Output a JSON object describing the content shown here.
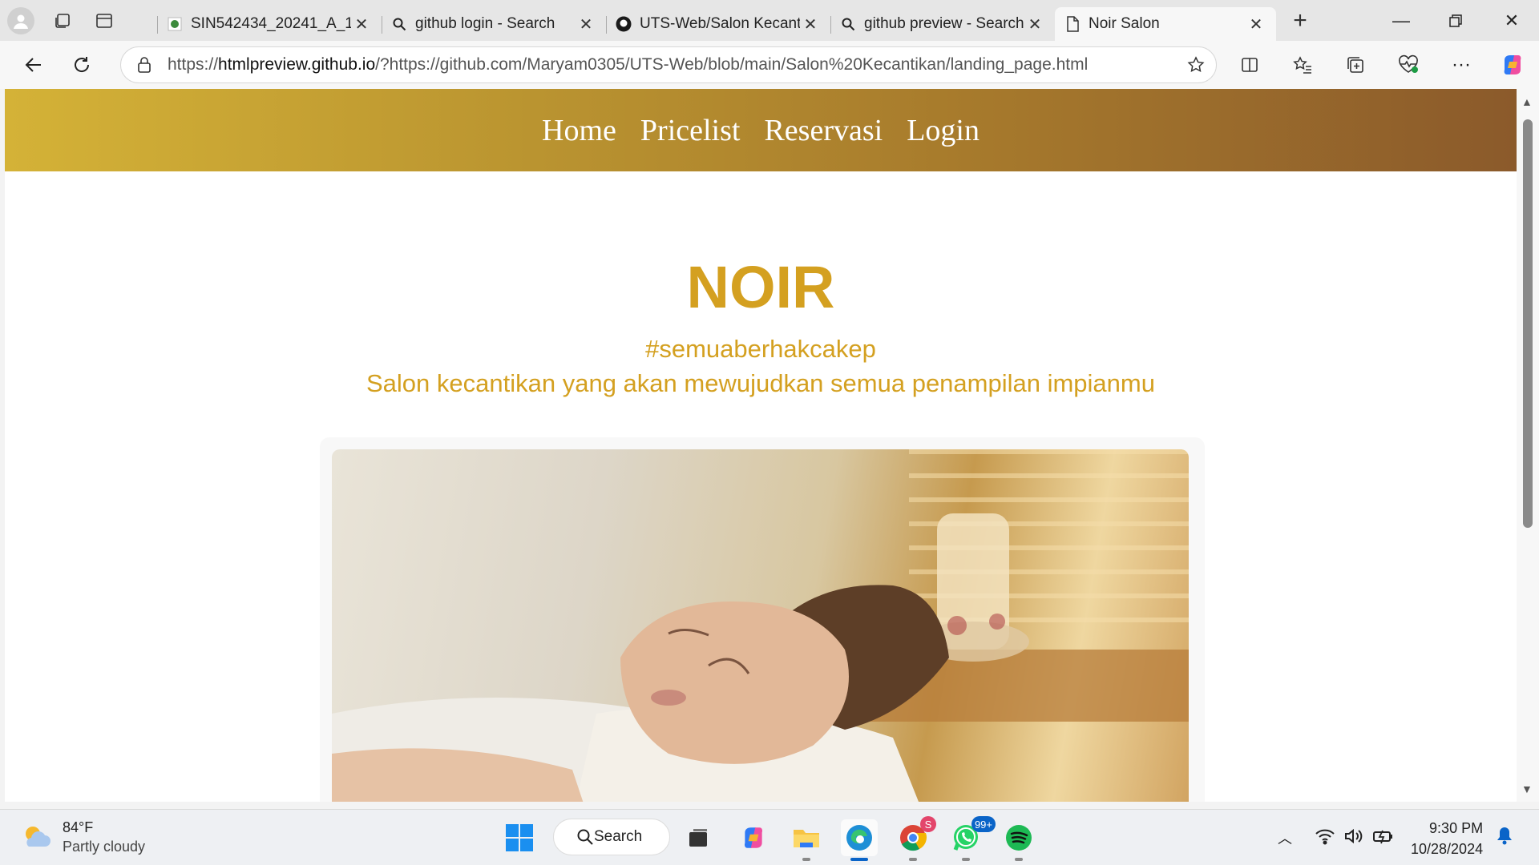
{
  "browser": {
    "tabs": [
      {
        "title": "SIN542434_20241_A_14",
        "icon": "university-favicon-icon",
        "active": false
      },
      {
        "title": "github login - Search",
        "icon": "search-icon",
        "active": false
      },
      {
        "title": "UTS-Web/Salon Kecanti",
        "icon": "github-icon",
        "active": false
      },
      {
        "title": "github preview - Search",
        "icon": "search-icon",
        "active": false
      },
      {
        "title": "Noir Salon",
        "icon": "page-icon",
        "active": true
      }
    ],
    "address": {
      "prefix": "https://",
      "host": "htmlpreview.github.io",
      "rest": "/?https://github.com/Maryam0305/UTS-Web/blob/main/Salon%20Kecantikan/landing_page.html"
    }
  },
  "site": {
    "nav": [
      "Home",
      "Pricelist",
      "Reservasi",
      "Login"
    ],
    "brand": "NOIR",
    "hashtag": "#semuaberhakcakep",
    "tagline": "Salon kecantikan yang akan mewujudkan semua penampilan impianmu",
    "accent": "#d4a020"
  },
  "taskbar": {
    "weather": {
      "temp": "84°F",
      "condition": "Partly cloudy"
    },
    "search_label": "Search",
    "whatsapp_badge": "99+",
    "chrome_badge": "S",
    "time": "9:30 PM",
    "date": "10/28/2024"
  }
}
